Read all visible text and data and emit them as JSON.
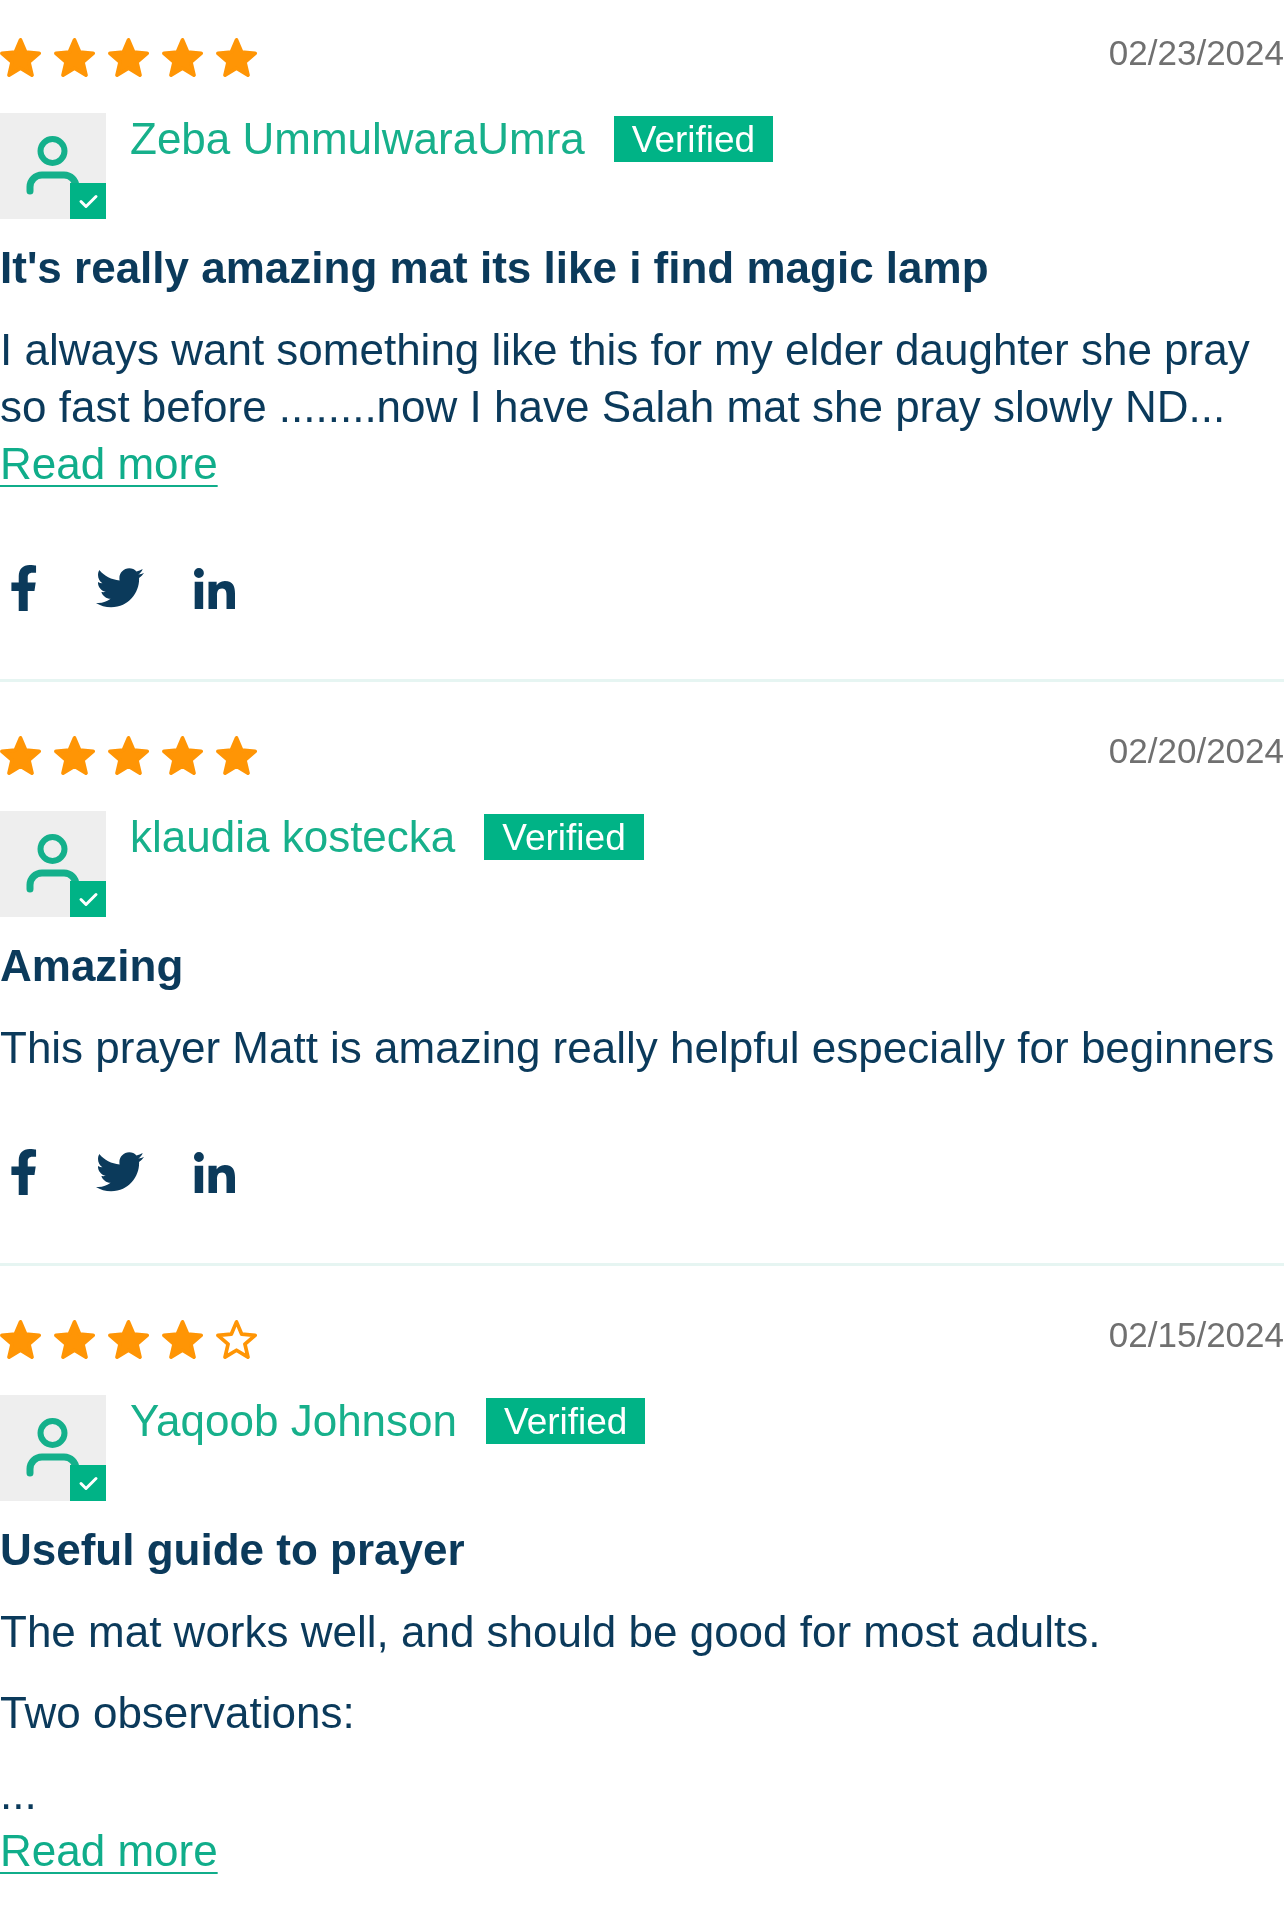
{
  "reviews": [
    {
      "stars": 5,
      "date": "02/23/2024",
      "author": "Zeba UmmulwaraUmra",
      "verified": true,
      "badge": "Verified",
      "title": "It's really amazing mat its like i find magic lamp",
      "body": [
        "I always want something like this for my elder daughter she pray so fast before ........now I have Salah mat she pray slowly ND..."
      ],
      "read_more": "Read more",
      "share_links": true
    },
    {
      "stars": 5,
      "date": "02/20/2024",
      "author": "klaudia kostecka",
      "verified": true,
      "badge": "Verified",
      "title": "Amazing",
      "body": [
        "This prayer Matt is amazing really helpful especially for beginners"
      ],
      "share_links": true
    },
    {
      "stars": 4,
      "date": "02/15/2024",
      "author": "Yaqoob Johnson",
      "verified": true,
      "badge": "Verified",
      "title": "Useful guide to prayer",
      "body": [
        "The mat works well, and should be good for most adults.",
        "Two observations:",
        "..."
      ],
      "read_more": "Read more",
      "share_links": false
    }
  ]
}
